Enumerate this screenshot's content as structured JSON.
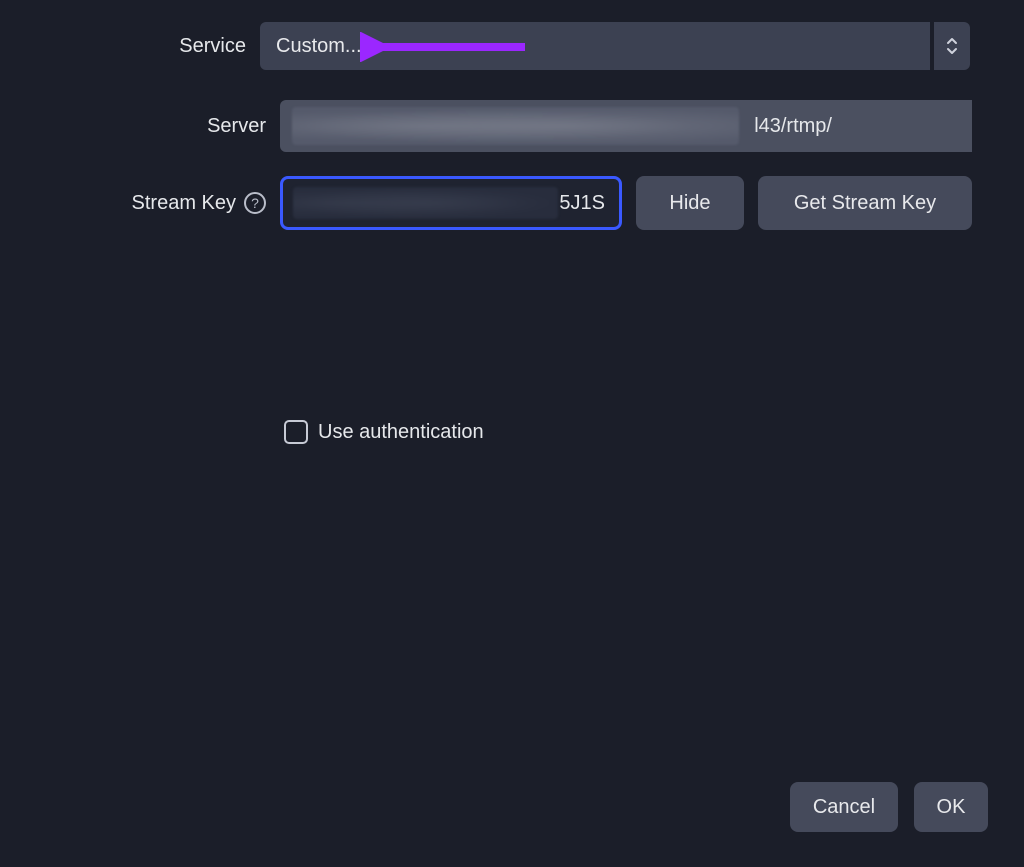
{
  "labels": {
    "service": "Service",
    "server": "Server",
    "stream_key": "Stream Key",
    "use_auth": "Use authentication"
  },
  "fields": {
    "service_selected": "Custom...",
    "server_value_visible": "l43/rtmp/",
    "stream_key_visible": "5J1S"
  },
  "buttons": {
    "hide": "Hide",
    "get_stream_key": "Get Stream Key",
    "cancel": "Cancel",
    "ok": "OK"
  },
  "checkboxes": {
    "use_auth_checked": false
  },
  "colors": {
    "background": "#1b1e29",
    "field_bg": "#3c4152",
    "input_dark_bg": "#1f2330",
    "focus_border": "#3a59ff",
    "button_bg": "#454a5b",
    "text": "#e6e8eb",
    "annotation_arrow": "#9b27ff"
  }
}
